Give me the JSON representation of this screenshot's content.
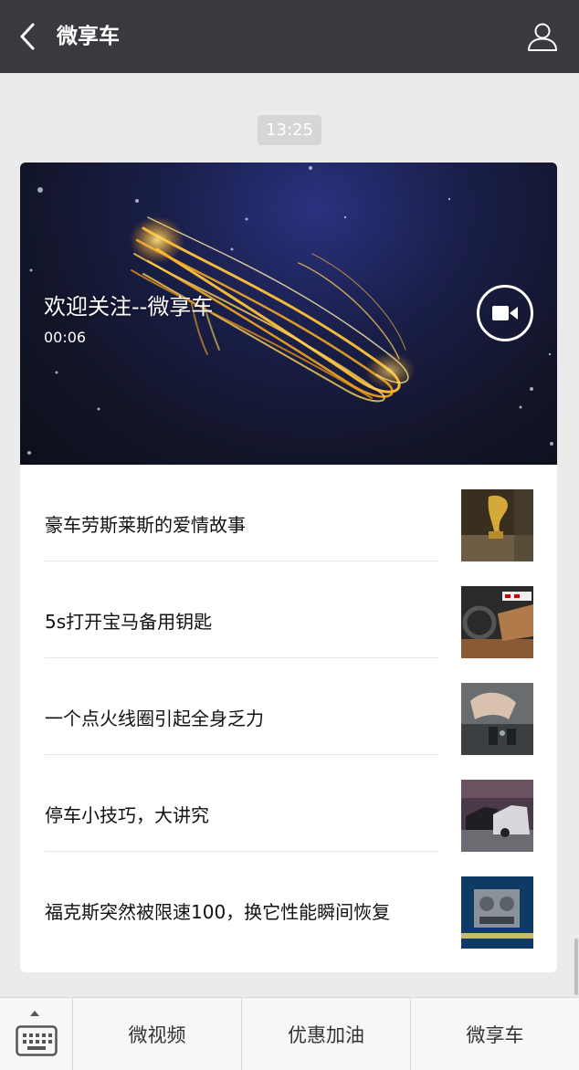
{
  "header": {
    "title": "微享车",
    "back_icon": "chevron-left-icon",
    "profile_icon": "person-icon"
  },
  "timestamp": "13:25",
  "video": {
    "title": "欢迎关注--微享车",
    "duration": "00:06",
    "icon": "video-camera-icon"
  },
  "articles": [
    {
      "title": "豪车劳斯莱斯的爱情故事",
      "thumb": "car-ornament-thumbnail"
    },
    {
      "title": "5s打开宝马备用钥匙",
      "thumb": "car-interior-thumbnail"
    },
    {
      "title": "一个点火线圈引起全身乏力",
      "thumb": "engine-hand-thumbnail"
    },
    {
      "title": "停车小技巧，大讲究",
      "thumb": "parked-cars-thumbnail"
    },
    {
      "title": "福克斯突然被限速100，换它性能瞬间恢复",
      "thumb": "engine-part-thumbnail"
    }
  ],
  "bottom_menu": {
    "keyboard_icon": "keyboard-icon",
    "items": [
      {
        "label": "微视频"
      },
      {
        "label": "优惠加油"
      },
      {
        "label": "微享车"
      }
    ]
  },
  "colors": {
    "header_bg": "#393a3f",
    "page_bg": "#ebebeb",
    "timestamp_bg": "#d6d6d6"
  }
}
